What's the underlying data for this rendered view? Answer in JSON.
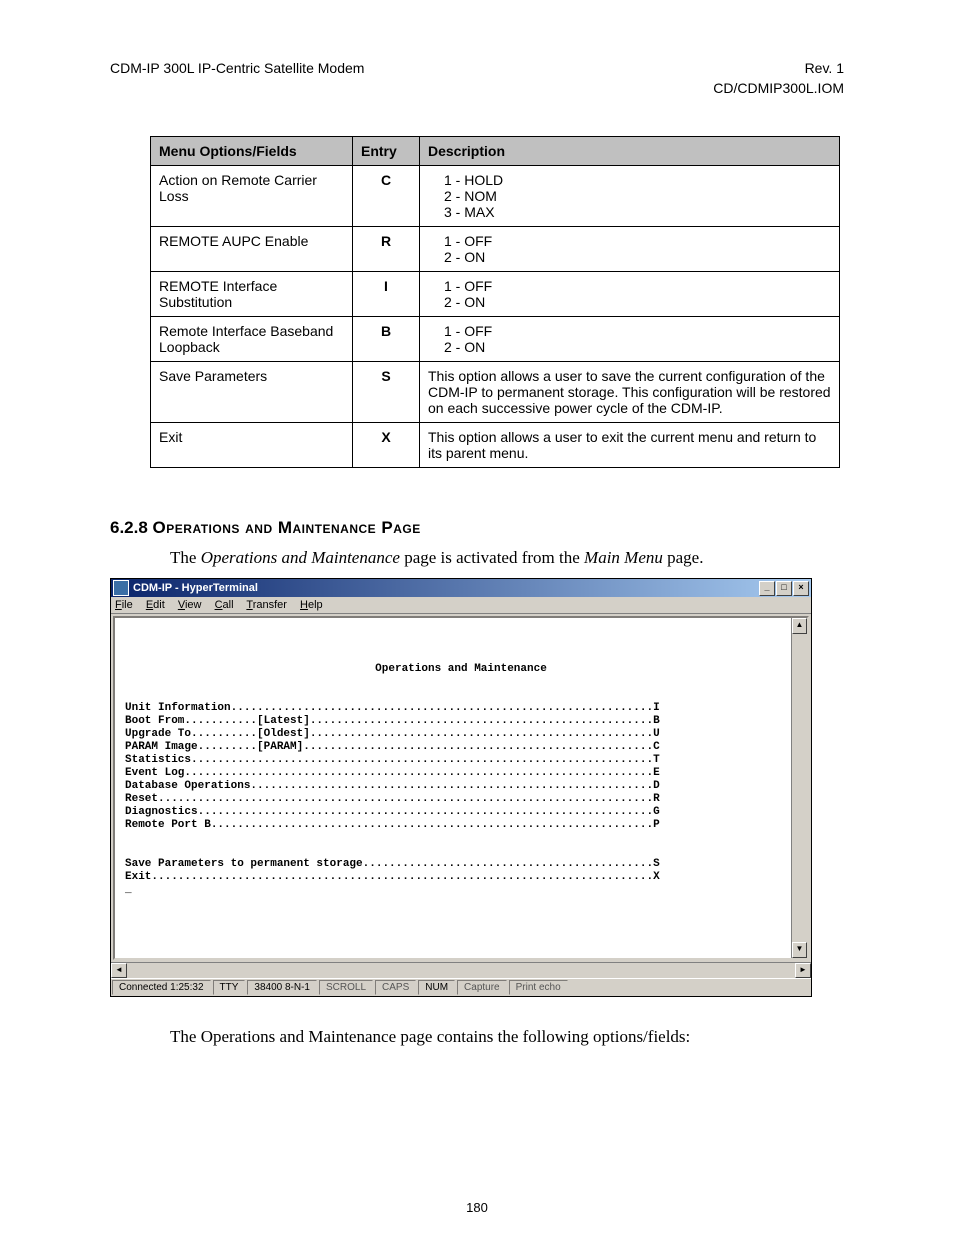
{
  "header": {
    "left": "CDM-IP 300L IP-Centric Satellite Modem",
    "right1": "Rev. 1",
    "right2": "CD/CDMIP300L.IOM"
  },
  "table": {
    "headers": {
      "col1": "Menu Options/Fields",
      "col2": "Entry",
      "col3": "Description"
    },
    "rows": [
      {
        "option": "Action on Remote Carrier Loss",
        "entry": "C",
        "desc": [
          "1 - HOLD",
          "2 - NOM",
          "3 - MAX"
        ]
      },
      {
        "option": "REMOTE AUPC Enable",
        "entry": "R",
        "desc": [
          "1 - OFF",
          "2 - ON"
        ]
      },
      {
        "option": "REMOTE Interface Substitution",
        "entry": "I",
        "desc": [
          "1 - OFF",
          "2 - ON"
        ]
      },
      {
        "option": "Remote Interface Baseband Loopback",
        "entry": "B",
        "desc": [
          "1 - OFF",
          "2 - ON"
        ]
      },
      {
        "option": "Save Parameters",
        "entry": "S",
        "desc_text": "This option allows a user to save the current configuration of the CDM-IP to permanent storage. This configuration will be restored on each successive power cycle of the CDM-IP."
      },
      {
        "option": "Exit",
        "entry": "X",
        "desc_text": "This option allows a user to exit the current menu and return to its parent menu."
      }
    ]
  },
  "section": {
    "number": "6.2.8",
    "title": "Operations and Maintenance Page",
    "intro_pre": "The ",
    "intro_ital1": "Operations and Maintenance",
    "intro_mid": " page is activated from the ",
    "intro_ital2": "Main Menu",
    "intro_post": " page.",
    "footer_pre": "The ",
    "footer_ital": "Operations and Maintenance",
    "footer_post": " page contains the following options/fields:"
  },
  "hyperterminal": {
    "title": "CDM-IP - HyperTerminal",
    "menu": {
      "file": "File",
      "edit": "Edit",
      "view": "View",
      "call": "Call",
      "transfer": "Transfer",
      "help": "Help"
    },
    "screen_title": "Operations and Maintenance",
    "lines": [
      "Unit Information................................................................I",
      "Boot From...........[Latest]....................................................B",
      "Upgrade To..........[Oldest]....................................................U",
      "PARAM Image.........[PARAM].....................................................C",
      "Statistics......................................................................T",
      "Event Log.......................................................................E",
      "Database Operations.............................................................D",
      "Reset...........................................................................R",
      "Diagnostics.....................................................................G",
      "Remote Port B...................................................................P",
      "",
      "",
      "Save Parameters to permanent storage............................................S",
      "Exit............................................................................X",
      "_"
    ],
    "status": {
      "connected": "Connected 1:25:32",
      "dev": "TTY",
      "settings": "38400 8-N-1",
      "scroll": "SCROLL",
      "caps": "CAPS",
      "num": "NUM",
      "capture": "Capture",
      "printecho": "Print echo"
    }
  },
  "page_number": "180"
}
